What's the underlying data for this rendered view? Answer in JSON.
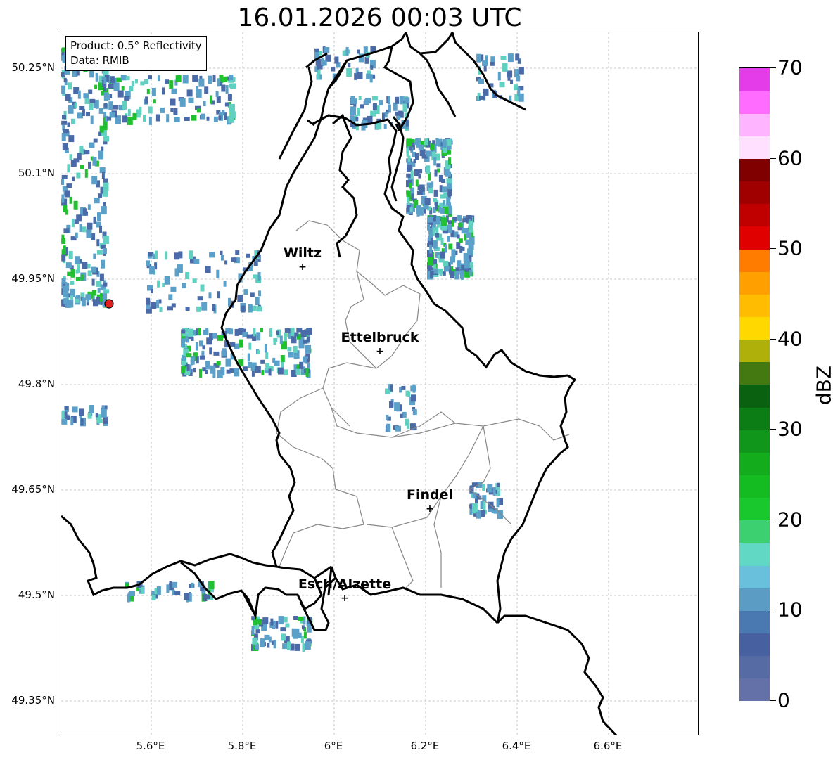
{
  "title": "16.01.2026 00:03 UTC",
  "info_box": {
    "line1": "Product: 0.5° Reflectivity",
    "line2": "Data: RMIB"
  },
  "lat_labels": [
    "50.25°N",
    "50.1°N",
    "49.95°N",
    "49.8°N",
    "49.65°N",
    "49.5°N",
    "49.35°N"
  ],
  "lon_labels": [
    "5.6°E",
    "5.8°E",
    "6°E",
    "6.2°E",
    "6.4°E",
    "6.6°E"
  ],
  "cities": [
    {
      "name": "Wiltz"
    },
    {
      "name": "Ettelbruck"
    },
    {
      "name": "Findel"
    },
    {
      "name": "Esch/Alzette"
    }
  ],
  "colorbar": {
    "title": "dBZ",
    "tick_labels": [
      "0",
      "10",
      "20",
      "30",
      "40",
      "50",
      "60",
      "70"
    ],
    "colors": [
      "#6470a8",
      "#566aa4",
      "#4660a0",
      "#4a78b0",
      "#5a9cc4",
      "#68c0dc",
      "#60d8c4",
      "#3cd070",
      "#18c82c",
      "#14bc22",
      "#12ac1c",
      "#10961a",
      "#0c7c14",
      "#0a6210",
      "#447810",
      "#b0b00a",
      "#ffd800",
      "#ffbc00",
      "#ffa000",
      "#ff7c00",
      "#e00000",
      "#c00000",
      "#a00000",
      "#800000",
      "#ffe0ff",
      "#ffb4ff",
      "#ff6cff",
      "#e43ce8"
    ]
  },
  "radar_site_color": "#e02020",
  "precip_palette": [
    "#4a6aa8",
    "#5aa0c8",
    "#60d0c0",
    "#20c030"
  ]
}
